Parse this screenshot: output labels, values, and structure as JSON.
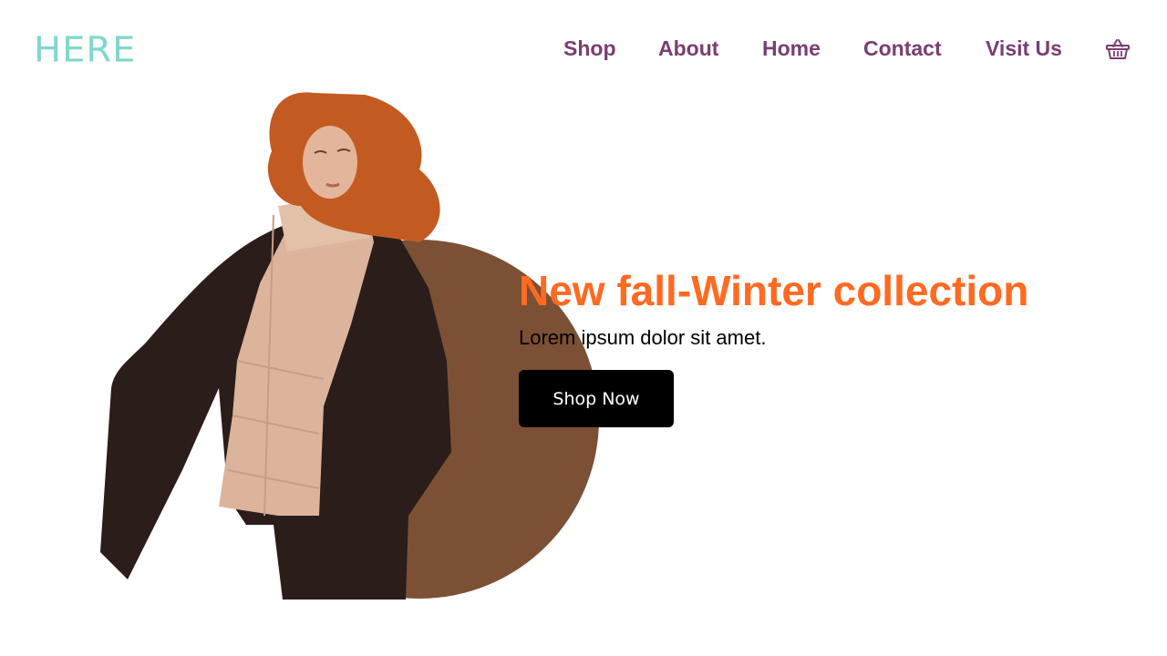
{
  "brand": {
    "logo_text": "HERE",
    "logo_color": "#7fd7cc"
  },
  "nav": {
    "items": [
      {
        "label": "Shop"
      },
      {
        "label": "About"
      },
      {
        "label": "Home"
      },
      {
        "label": "Contact"
      },
      {
        "label": "Visit Us"
      }
    ],
    "cart_icon": "basket-icon",
    "link_color": "#7a3d72"
  },
  "hero": {
    "headline": "New fall-Winter collection",
    "subtitle": "Lorem ipsum dolor sit amet.",
    "cta_label": "Shop Now",
    "headline_color": "#ff6a21",
    "circle_color": "#7c5034",
    "image_subject": "model-photo"
  }
}
